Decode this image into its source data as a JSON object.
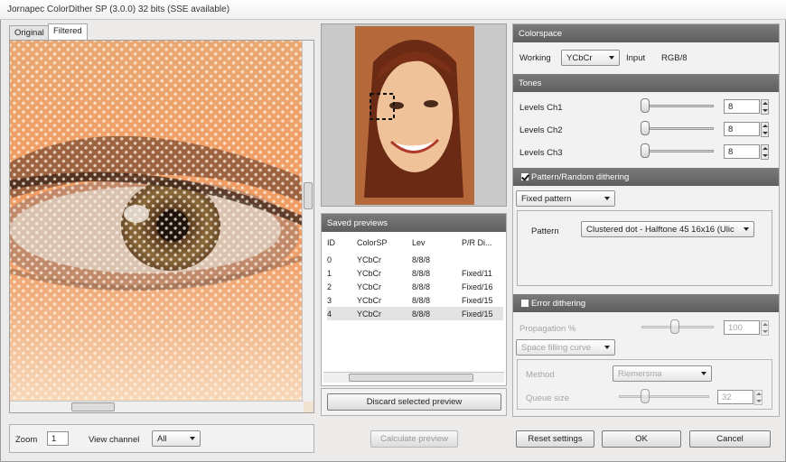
{
  "window": {
    "title": "Jornapec ColorDither SP (3.0.0) 32 bits (SSE available)"
  },
  "tabs": {
    "original": "Original",
    "filtered": "Filtered"
  },
  "left_footer": {
    "zoom_label": "Zoom",
    "zoom_value": "1",
    "view_channel_label": "View channel",
    "view_channel_value": "All"
  },
  "saved_previews": {
    "header": "Saved previews",
    "columns": [
      "ID",
      "ColorSP",
      "Lev",
      "P/R Di..."
    ],
    "rows": [
      {
        "id": "0",
        "colorsp": "YCbCr",
        "lev": "8/8/8",
        "pr": ""
      },
      {
        "id": "1",
        "colorsp": "YCbCr",
        "lev": "8/8/8",
        "pr": "Fixed/11"
      },
      {
        "id": "2",
        "colorsp": "YCbCr",
        "lev": "8/8/8",
        "pr": "Fixed/16"
      },
      {
        "id": "3",
        "colorsp": "YCbCr",
        "lev": "8/8/8",
        "pr": "Fixed/15"
      },
      {
        "id": "4",
        "colorsp": "YCbCr",
        "lev": "8/8/8",
        "pr": "Fixed/15"
      }
    ],
    "selected_index": 4,
    "discard_button": "Discard selected preview"
  },
  "calculate_button": "Calculate preview",
  "colorspace": {
    "header": "Colorspace",
    "working_label": "Working",
    "working_value": "YCbCr",
    "input_label": "Input",
    "input_value": "RGB/8"
  },
  "tones": {
    "header": "Tones",
    "channels": [
      {
        "label": "Levels Ch1",
        "value": "8"
      },
      {
        "label": "Levels Ch2",
        "value": "8"
      },
      {
        "label": "Levels Ch3",
        "value": "8"
      }
    ]
  },
  "pattern_dithering": {
    "checked": true,
    "header": "Pattern/Random dithering",
    "mode_value": "Fixed pattern",
    "pattern_label": "Pattern",
    "pattern_value": "Clustered dot - Halftone 45 16x16 (Ulic"
  },
  "error_dithering": {
    "checked": false,
    "header": "Error dithering",
    "propagation_label": "Propagation %",
    "propagation_value": "100",
    "curve_value": "Space filling curve",
    "method_label": "Method",
    "method_value": "Riemersma",
    "queue_label": "Queue size",
    "queue_value": "32"
  },
  "buttons": {
    "reset": "Reset settings",
    "ok": "OK",
    "cancel": "Cancel"
  },
  "colors": {
    "section_header": "#666666",
    "selection_row": "#e3e3e3"
  }
}
